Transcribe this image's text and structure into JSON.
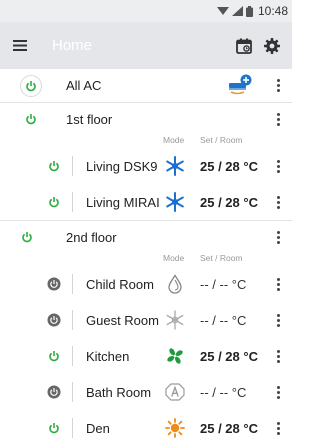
{
  "status_bar": {
    "time": "10:48"
  },
  "app_bar": {
    "title": "Home",
    "menu_icon": "menu-icon",
    "actions": [
      "calendar-icon",
      "gear-icon"
    ]
  },
  "colors": {
    "power_on": "#2dae3f",
    "power_off": "#666666",
    "snow": "#1b6fd0",
    "fan": "#1f9a3c",
    "sun": "#f08a19",
    "all_ac_blue": "#1f74c9"
  },
  "list": {
    "all": {
      "name": "All AC",
      "icon": "add-ac-icon"
    },
    "headers": {
      "mode": "Mode",
      "setroom": "Set / Room"
    },
    "floors": [
      {
        "name": "1st floor",
        "rooms": [
          {
            "name": "Living DSK9",
            "power": "on",
            "mode": "snowflake-icon",
            "temps": "25 / 28",
            "unit": "°C"
          },
          {
            "name": "Living MIRAI",
            "power": "on",
            "mode": "snowflake-icon",
            "temps": "25 / 28",
            "unit": "°C"
          }
        ]
      },
      {
        "name": "2nd floor",
        "rooms": [
          {
            "name": "Child Room",
            "power": "off",
            "mode": "drop-icon",
            "temps": "-- / --",
            "unit": "°C"
          },
          {
            "name": "Guest Room",
            "power": "off",
            "mode": "snowflake-icon",
            "temps": "-- / --",
            "unit": "°C"
          },
          {
            "name": "Kitchen",
            "power": "on",
            "mode": "fan-icon",
            "temps": "25 / 28",
            "unit": "°C"
          },
          {
            "name": "Bath Room",
            "power": "off",
            "mode": "auto-icon",
            "temps": "-- / --",
            "unit": "°C"
          },
          {
            "name": "Den",
            "power": "on",
            "mode": "sun-icon",
            "temps": "25 / 28",
            "unit": "°C"
          }
        ]
      }
    ]
  }
}
